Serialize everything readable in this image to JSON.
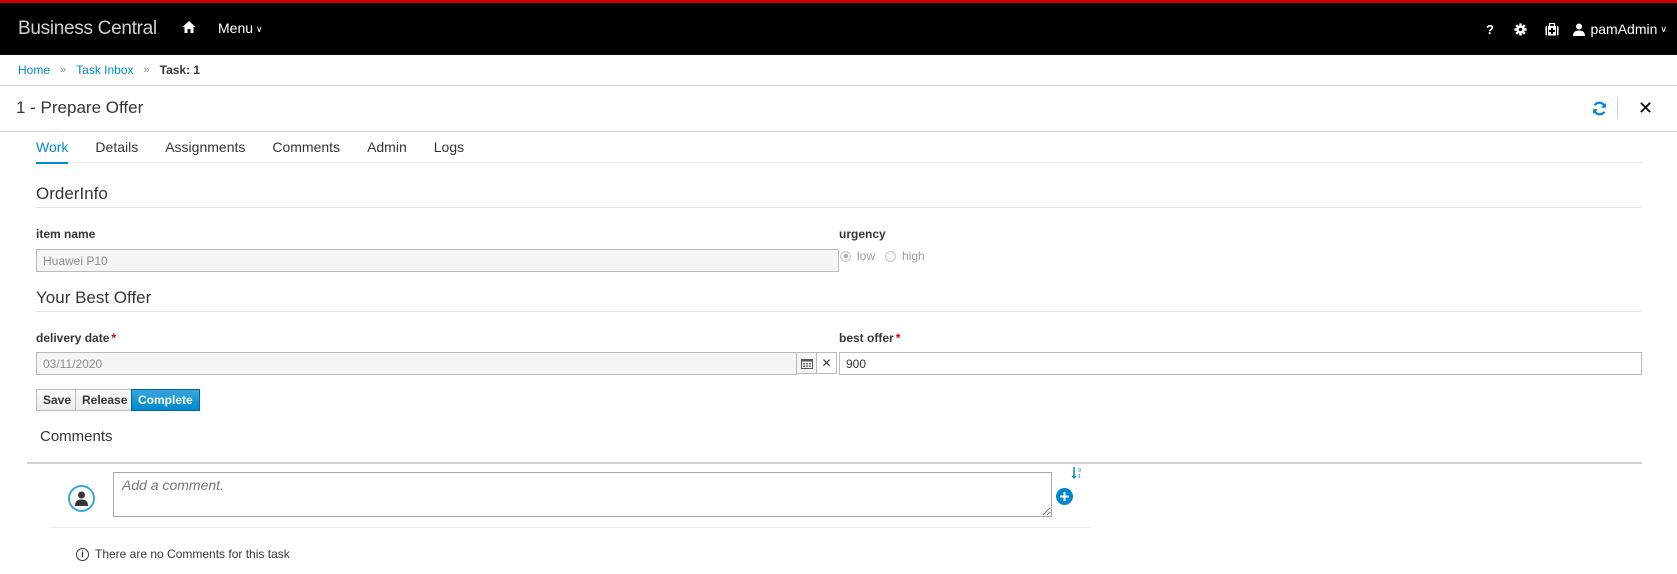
{
  "app": {
    "title": "Business Central",
    "menu_label": "Menu",
    "user_name": "pamAdmin",
    "icons": [
      "home-icon",
      "help-icon",
      "gear-icon",
      "first-aid-kit-icon",
      "user-icon"
    ],
    "help_glyph": "?",
    "brand_accent": "#cc0000"
  },
  "breadcrumb": {
    "items": [
      {
        "label": "Home"
      },
      {
        "label": "Task Inbox"
      }
    ],
    "separator": "»",
    "current": "Task: 1"
  },
  "page": {
    "title": "1 - Prepare Offer",
    "close_glyph": "✕"
  },
  "tabs": [
    {
      "label": "Work",
      "active": true
    },
    {
      "label": "Details"
    },
    {
      "label": "Assignments"
    },
    {
      "label": "Comments"
    },
    {
      "label": "Admin"
    },
    {
      "label": "Logs"
    }
  ],
  "form": {
    "order_info": {
      "title": "OrderInfo",
      "item_name_label": "item name",
      "item_name_value": "Huawei P10",
      "urgency_label": "urgency",
      "urgency_options": [
        "low",
        "high"
      ],
      "urgency_selected": "low"
    },
    "best_offer_section": {
      "title": "Your Best Offer",
      "delivery_date_label": "delivery date",
      "delivery_date_value": "03/11/2020",
      "best_offer_label": "best offer",
      "best_offer_value": "900",
      "required_marker": "*",
      "clear_glyph": "✕"
    },
    "buttons": {
      "save": "Save",
      "release": "Release",
      "complete": "Complete"
    }
  },
  "comments": {
    "title": "Comments",
    "placeholder": "Add a comment.",
    "empty_message": "There are no Comments for this task",
    "info_glyph": "i"
  },
  "colors": {
    "primary": "#0088ce",
    "required": "#cc0000"
  }
}
